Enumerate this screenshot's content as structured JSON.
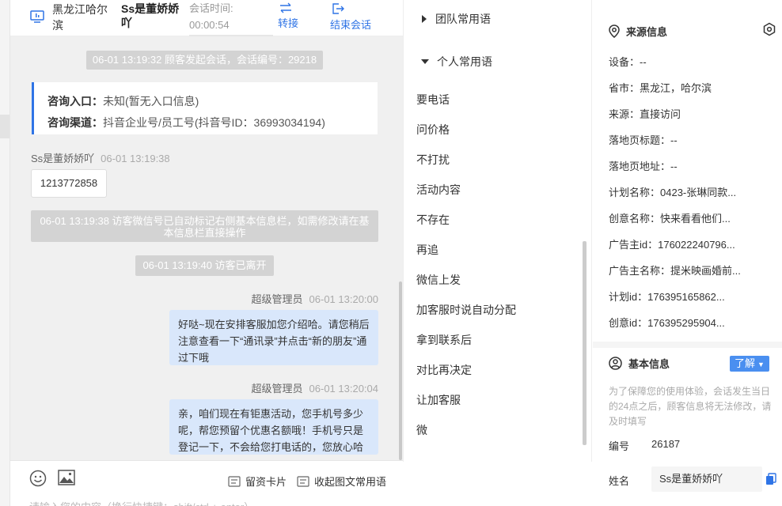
{
  "header": {
    "region": "黑龙江哈尔滨",
    "visitor_name": "Ss是董娇娇吖",
    "session_time_label": "会话时间:",
    "session_time_value": "00:00:54",
    "transfer_label": "转接",
    "end_label": "结束会话"
  },
  "chat": {
    "start_notice": "06-01 13:19:32 顾客发起会话，会话编号：29218",
    "entry_label": "咨询入口：",
    "entry_value": "未知(暂无入口信息)",
    "channel_label": "咨询渠道：",
    "channel_value": "抖音企业号/员工号(抖音号ID：36993034194)",
    "visitor_sender": "Ss是董娇娇吖",
    "visitor_time": "06-01 13:19:38",
    "visitor_message": "1213772858",
    "wechat_notice": "06-01 13:19:38 访客微信号已自动标记右侧基本信息栏，如需修改请在基本信息栏直接操作",
    "left_notice": "06-01 13:19:40 访客已离开",
    "msg1_sender": "超级管理员",
    "msg1_time": "06-01 13:20:00",
    "msg1_text": "好哒~现在安排客服加您介绍哈。请您稍后注意查看一下“通讯录”并点击“新的朋友”通过下哦",
    "msg2_sender": "超级管理员",
    "msg2_time": "06-01 13:20:04",
    "msg2_text": "亲，咱们现在有钜惠活动，您手机号多少呢，帮您预留个优惠名额哦！手机号只是登记一下，不会给您打电话的，您放心哈"
  },
  "input": {
    "card_label": "留资卡片",
    "collapse_label": "收起图文常用语",
    "placeholder": "请输入您的内容（换行快捷键：shift/ctrl + enter）"
  },
  "phrases": {
    "team_label": "团队常用语",
    "personal_label": "个人常用语",
    "items": [
      "要电话",
      "问价格",
      "不打扰",
      "活动内容",
      "不存在",
      "再追",
      "微信上发",
      "加客服时说自动分配",
      "拿到联系后",
      "对比再决定",
      "让加客服",
      "微"
    ]
  },
  "source": {
    "title": "来源信息",
    "rows": [
      "设备：--",
      "省市：黑龙江，哈尔滨",
      "来源：直接访问",
      "落地页标题：--",
      "落地页地址：--",
      "计划名称：0423-张琳同款...",
      "创意名称：快来看看他们...",
      "广告主id：176022240796...",
      "广告主名称：提米映画婚前...",
      "计划id：176395165862...",
      "创意id：176395295904..."
    ]
  },
  "basic": {
    "title": "基本信息",
    "learn_label": "了解",
    "note": "为了保障您的使用体验，会话发生当日的24点之后，顾客信息将无法修改，请及时填写",
    "id_label": "编号",
    "id_value": "26187",
    "name_label": "姓名",
    "name_value": "Ss是董娇娇吖"
  },
  "colors": {
    "accent": "#2f74e6",
    "bubble": "#d9e7fb",
    "notice": "#d3d3d3"
  }
}
